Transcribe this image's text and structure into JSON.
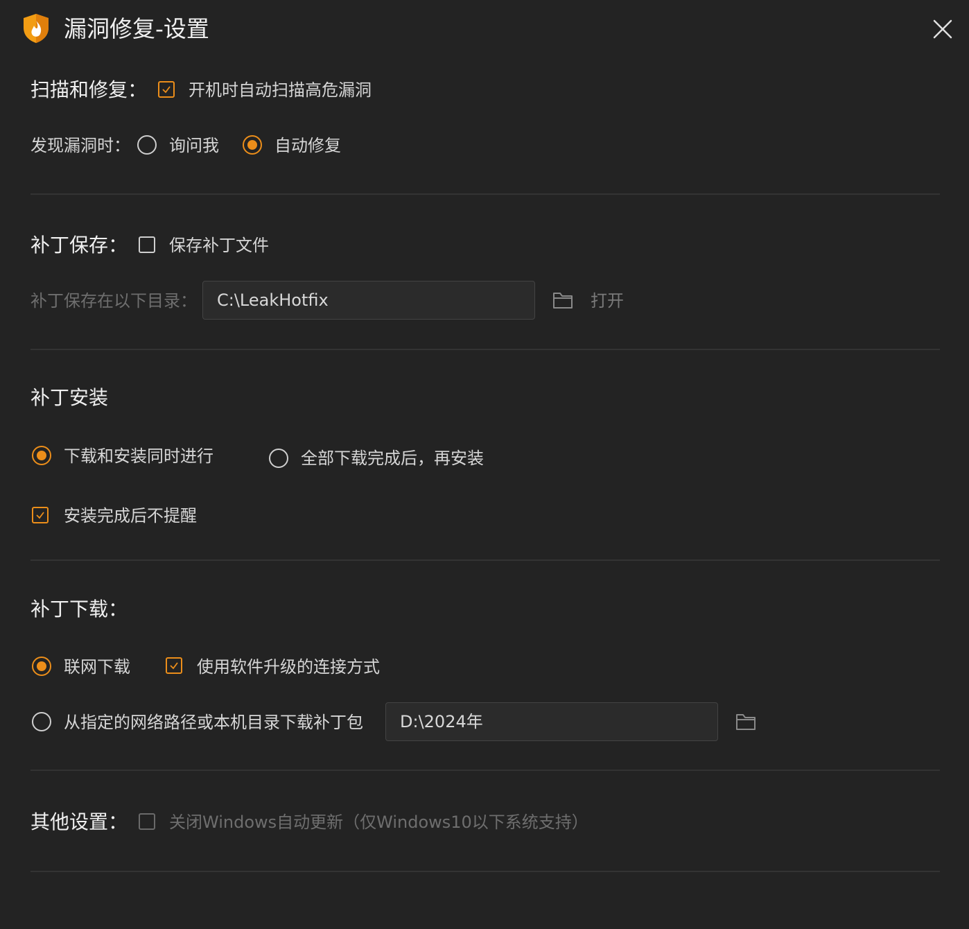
{
  "window": {
    "title": "漏洞修复-设置"
  },
  "colors": {
    "accent": "#ec8e1a",
    "background": "#232323"
  },
  "scan": {
    "section_title": "扫描和修复：",
    "auto_scan_label": "开机时自动扫描高危漏洞",
    "auto_scan_checked": true,
    "found_label": "发现漏洞时：",
    "options": [
      "询问我",
      "自动修复"
    ],
    "selected": "自动修复"
  },
  "patch_save": {
    "section_title": "补丁保存：",
    "save_label": "保存补丁文件",
    "save_checked": false,
    "dir_label": "补丁保存在以下目录：",
    "dir_value": "C:\\LeakHotfix",
    "open_label": "打开"
  },
  "install": {
    "section_title": "补丁安装",
    "options": [
      "下载和安装同时进行",
      "全部下载完成后，再安装"
    ],
    "selected": "下载和安装同时进行",
    "no_remind_label": "安装完成后不提醒",
    "no_remind_checked": true
  },
  "download": {
    "section_title": "补丁下载：",
    "online_label": "联网下载",
    "online_selected": true,
    "software_upgrade_label": "使用软件升级的连接方式",
    "software_upgrade_checked": true,
    "local_label": "从指定的网络路径或本机目录下载补丁包",
    "local_selected": false,
    "local_path_value": "D:\\2024年"
  },
  "other": {
    "section_title": "其他设置：",
    "disable_update_label": "关闭Windows自动更新（仅Windows10以下系统支持）",
    "disable_update_checked": false
  },
  "icons": {
    "logo": "shield-flame-icon",
    "close": "close-icon",
    "folder": "folder-icon"
  }
}
